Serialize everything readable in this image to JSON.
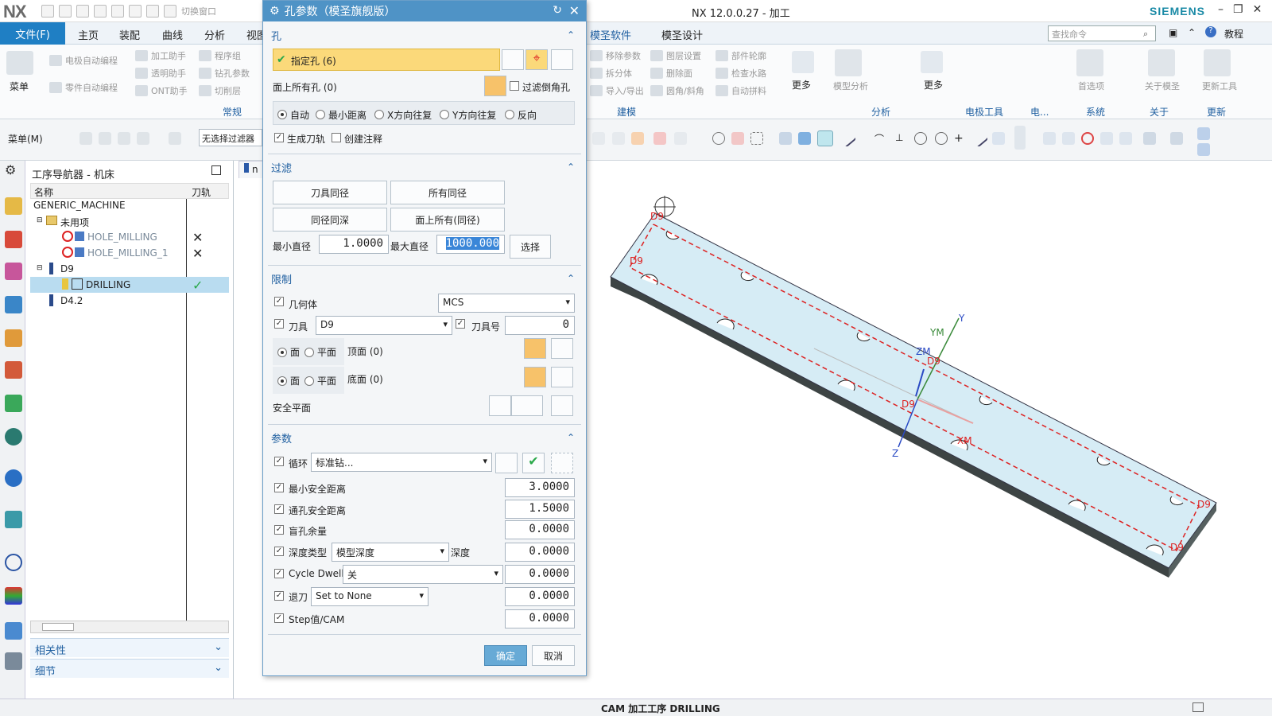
{
  "app": {
    "logo": "NX",
    "window_title": "NX 12.0.0.27 - 加工",
    "brand": "SIEMENS",
    "quick_access_extra": "切换窗口"
  },
  "menubar": {
    "file": "文件(F)",
    "tabs": [
      "主页",
      "装配",
      "曲线",
      "分析",
      "视图"
    ],
    "right_tabs": [
      "模圣软件",
      "模圣设计"
    ],
    "search_placeholder": "查找命令",
    "tutorial": "教程"
  },
  "ribbon": {
    "menu_label": "菜单",
    "left_items": [
      "电极自动编程",
      "加工助手",
      "程序组",
      "零件自动编程",
      "透明助手",
      "钻孔参数",
      "ONT助手",
      "切削层"
    ],
    "left_group": "常规",
    "mid_items": [
      "移除参数",
      "图层设置",
      "部件轮廓",
      "拆分体",
      "删除面",
      "检查水路",
      "导入/导出",
      "圆角/斜角",
      "自动拼料"
    ],
    "mid_group": "建模",
    "more": "更多",
    "groups_right": [
      "分析",
      "电极工具",
      "电...",
      "系统",
      "关于",
      "更新"
    ],
    "right_items": [
      "模型分析",
      "首选项",
      "关于模圣",
      "更新工具"
    ]
  },
  "toolbar": {
    "menu": "菜单(M)",
    "filter": "无选择过滤器"
  },
  "navigator": {
    "title": "工序导航器 - 机床",
    "col_name": "名称",
    "col_toolpath": "刀轨",
    "rows": [
      {
        "label": "GENERIC_MACHINE"
      },
      {
        "label": "未用项"
      },
      {
        "label": "HOLE_MILLING",
        "status": "✕"
      },
      {
        "label": "HOLE_MILLING_1",
        "status": "✕"
      },
      {
        "label": "D9"
      },
      {
        "label": "DRILLING",
        "status": "✓"
      },
      {
        "label": "D4.2"
      }
    ],
    "relations": "相关性",
    "details": "细节"
  },
  "dialog": {
    "title": "孔参数（模圣旗舰版）",
    "sec_hole": "孔",
    "specify_hole": "指定孔 (6)",
    "all_holes": "面上所有孔 (0)",
    "filter_chamfer": "过滤倒角孔",
    "modes": [
      "自动",
      "最小距离",
      "X方向往复",
      "Y方向往复",
      "反向"
    ],
    "gen_toolpath": "生成刀轨",
    "create_note": "创建注释",
    "sec_filter": "过滤",
    "f_same_tool": "刀具同径",
    "f_all_same": "所有同径",
    "f_same_depth": "同径同深",
    "f_all_on_face": "面上所有(同径)",
    "min_dia_label": "最小直径",
    "min_dia": "1.0000",
    "max_dia_label": "最大直径",
    "max_dia": "1000.000",
    "select": "选择",
    "sec_limit": "限制",
    "geometry": "几何体",
    "geometry_val": "MCS",
    "tool": "刀具",
    "tool_val": "D9",
    "tool_no": "刀具号",
    "tool_no_val": "0",
    "face": "面",
    "plane": "平面",
    "top_face": "顶面 (0)",
    "bottom_face": "底面 (0)",
    "safe_plane": "安全平面",
    "sec_params": "参数",
    "cycle": "循环",
    "cycle_val": "标准钻...",
    "min_safe": "最小安全距离",
    "min_safe_val": "3.0000",
    "thru_safe": "通孔安全距离",
    "thru_safe_val": "1.5000",
    "blind_allow": "盲孔余量",
    "blind_allow_val": "0.0000",
    "depth_type": "深度类型",
    "depth_type_val": "模型深度",
    "depth": "深度",
    "depth_val": "0.0000",
    "cycle_dwell": "Cycle Dwell",
    "cycle_dwell_val": "关",
    "cycle_dwell_num": "0.0000",
    "retract": "退刀",
    "retract_val": "Set to None",
    "retract_num": "0.0000",
    "step": "Step值/CAM",
    "step_val": "0.0000",
    "ok": "确定",
    "cancel": "取消"
  },
  "graphics": {
    "tab_label": "n",
    "labels": [
      "D9",
      "D9",
      "D9",
      "D9",
      "D9",
      "D9",
      "D9"
    ],
    "axes": {
      "xm": "XM",
      "ym": "YM",
      "zm": "ZM",
      "y": "Y",
      "z": "Z"
    }
  },
  "status": {
    "text": "CAM 加工工序 DRILLING"
  },
  "colors": {
    "accent": "#1f7fc4",
    "dialog_title": "#4f93c6",
    "highlight": "#fbd97a",
    "part": "#d6ecf5",
    "path": "#d22",
    "ok": "#2aa84a"
  }
}
